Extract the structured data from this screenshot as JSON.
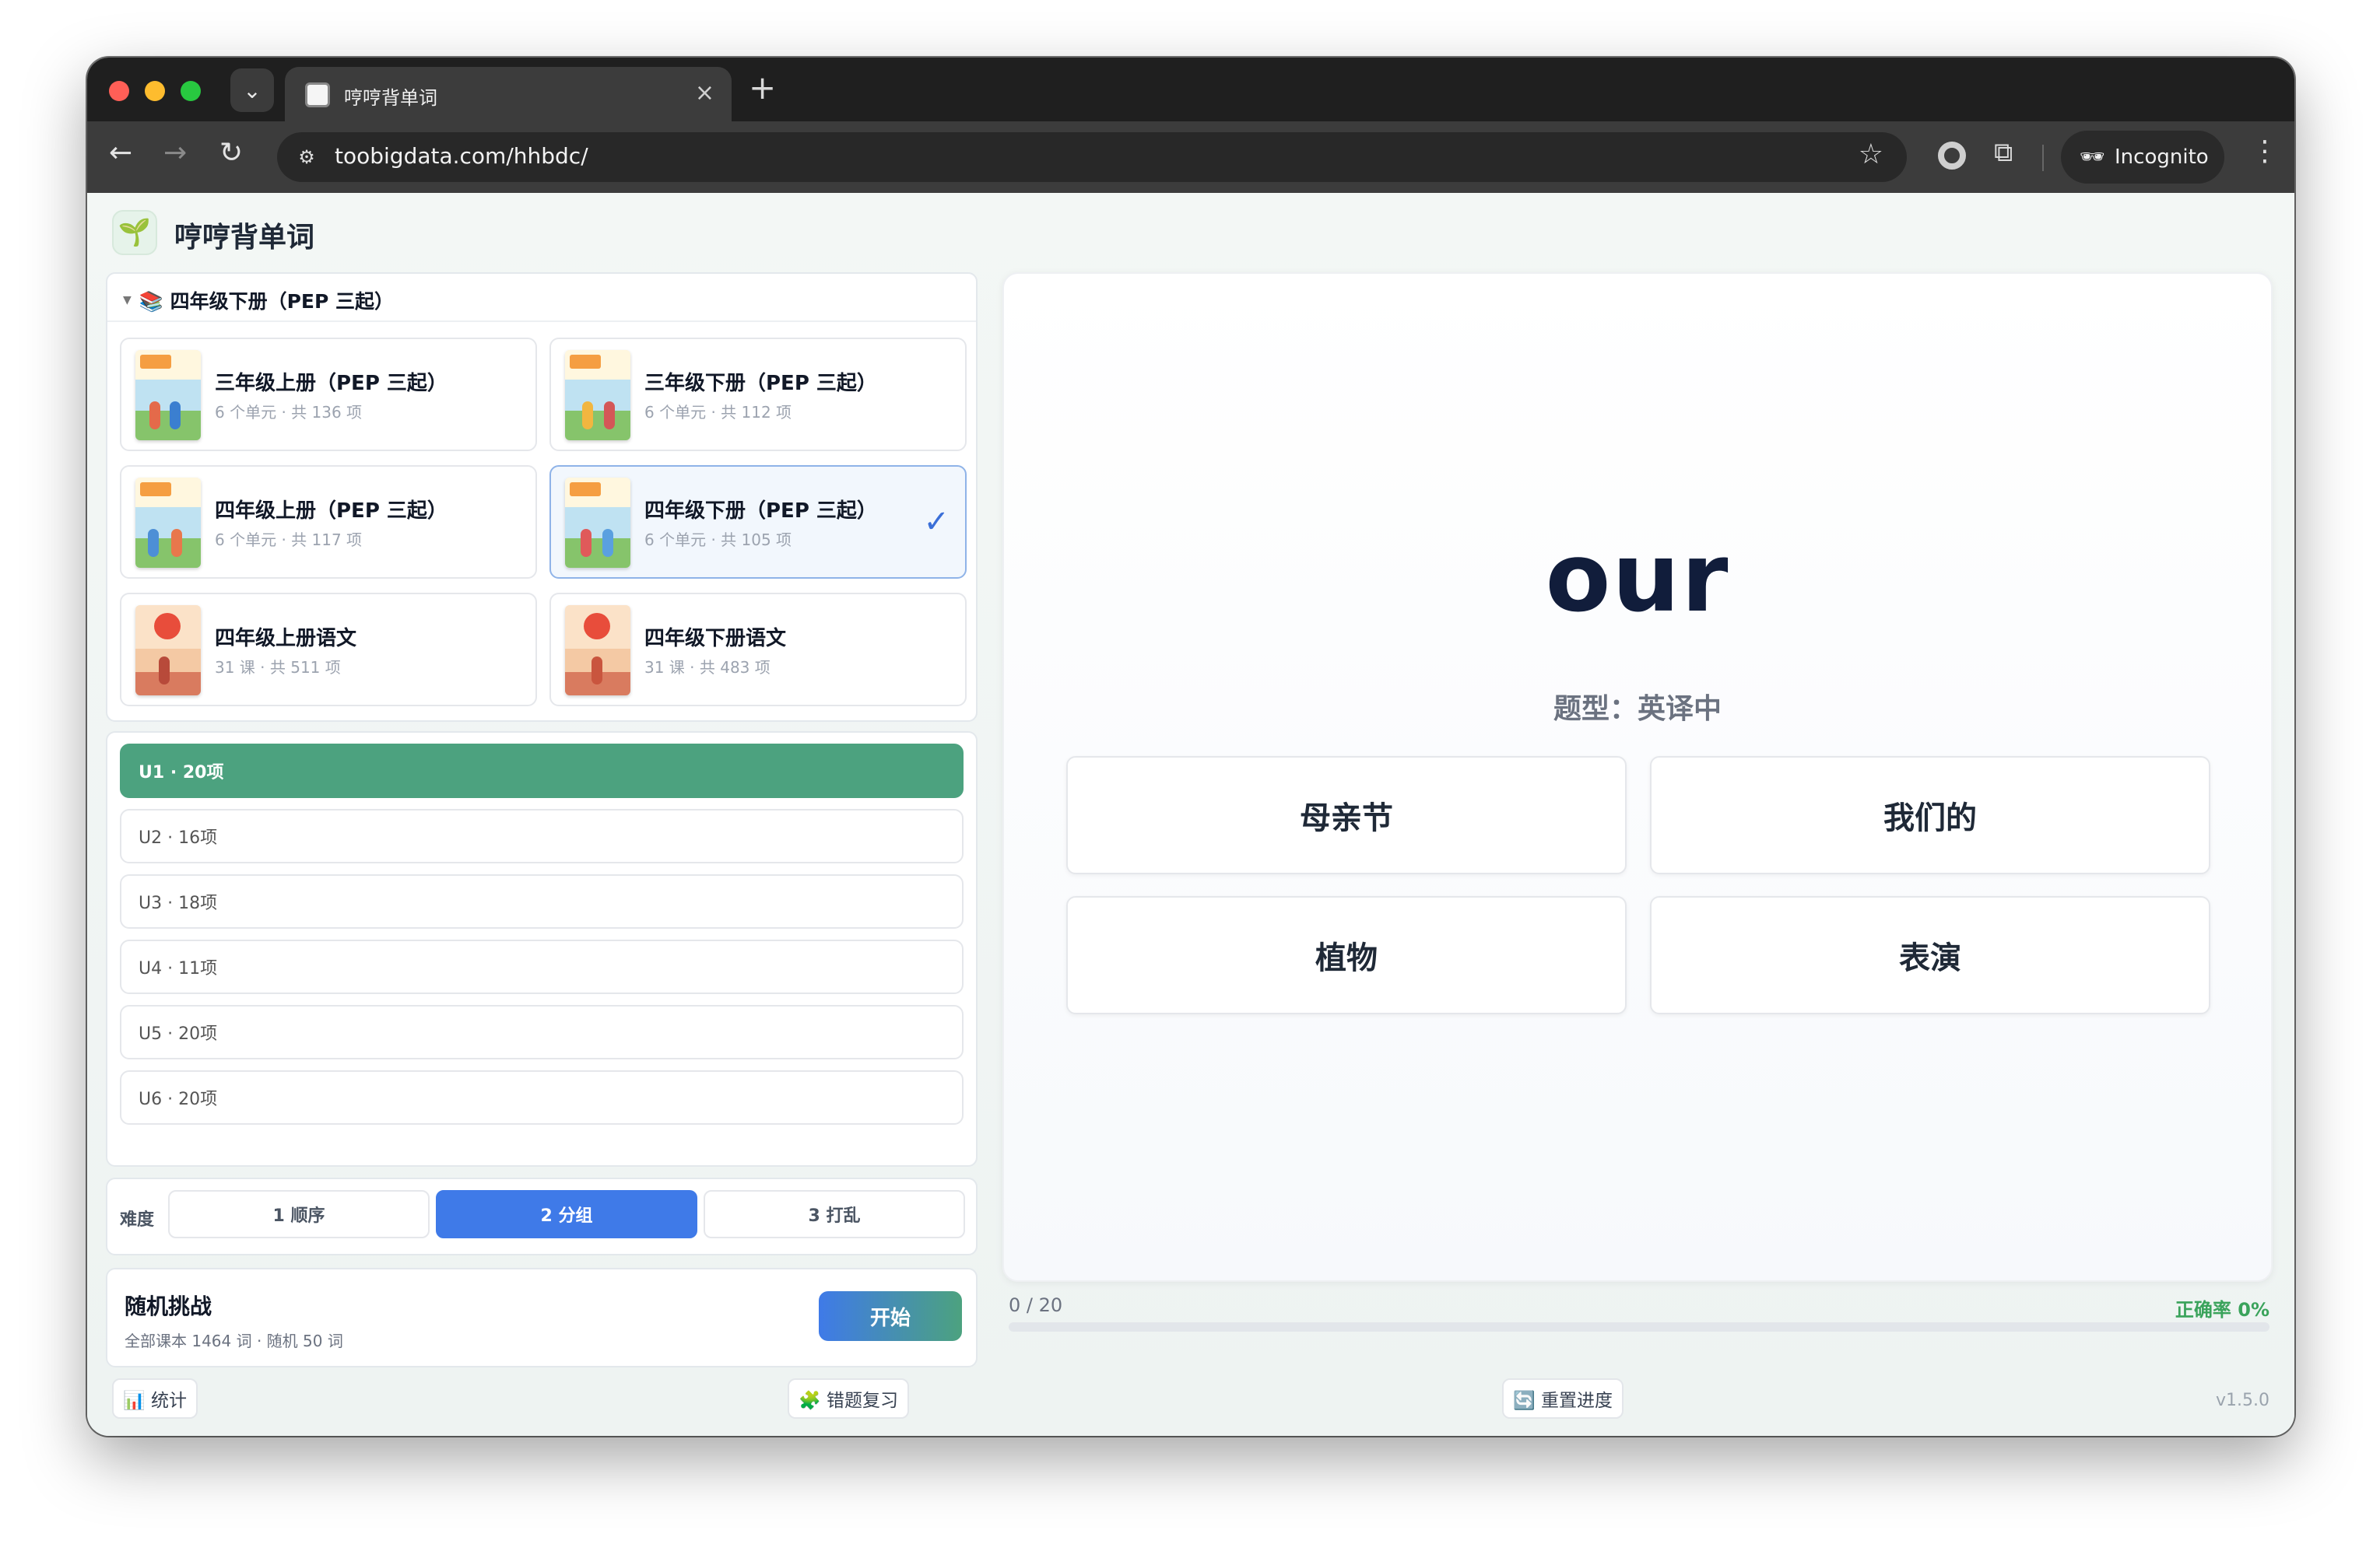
{
  "browser": {
    "tab_title": "哼哼背单词",
    "url": "toobigdata.com/hhbdc/",
    "incognito_label": "Incognito"
  },
  "app": {
    "title": "哼哼背单词",
    "logo_icon": "seedling-icon"
  },
  "book_panel": {
    "header": "📚 四年级下册（PEP 三起）",
    "books": [
      {
        "title": "三年级上册（PEP 三起）",
        "meta": "6 个单元 · 共 136 项",
        "cover": "english",
        "selected": false
      },
      {
        "title": "三年级下册（PEP 三起）",
        "meta": "6 个单元 · 共 112 项",
        "cover": "english",
        "selected": false
      },
      {
        "title": "四年级上册（PEP 三起）",
        "meta": "6 个单元 · 共 117 项",
        "cover": "english",
        "selected": false
      },
      {
        "title": "四年级下册（PEP 三起）",
        "meta": "6 个单元 · 共 105 项",
        "cover": "english",
        "selected": true
      },
      {
        "title": "四年级上册语文",
        "meta": "31 课 · 共 511 项",
        "cover": "chinese",
        "selected": false
      },
      {
        "title": "四年级下册语文",
        "meta": "31 课 · 共 483 项",
        "cover": "chinese",
        "selected": false
      }
    ],
    "check_mark": "✓"
  },
  "units": [
    {
      "label": "U1 · 20项",
      "active": true
    },
    {
      "label": "U2 · 16项",
      "active": false
    },
    {
      "label": "U3 · 18项",
      "active": false
    },
    {
      "label": "U4 · 11项",
      "active": false
    },
    {
      "label": "U5 · 20项",
      "active": false
    },
    {
      "label": "U6 · 20项",
      "active": false
    }
  ],
  "difficulty": {
    "label": "难度",
    "options": [
      "1 顺序",
      "2 分组",
      "3 打乱"
    ],
    "selected_index": 1
  },
  "challenge": {
    "title": "随机挑战",
    "subtitle": "全部课本 1464 词 · 随机 50 词",
    "start_label": "开始"
  },
  "quiz": {
    "word": "our",
    "type_label": "题型：英译中",
    "options": [
      "母亲节",
      "我们的",
      "植物",
      "表演"
    ]
  },
  "progress": {
    "text": "0 / 20",
    "fraction": 0,
    "accuracy": "正确率 0%"
  },
  "footer": {
    "stats_label": "📊 统计",
    "review_label": "🧩 错题复习",
    "reset_label": "🔄 重置进度",
    "version": "v1.5.0"
  },
  "colors": {
    "accent_green": "#4ca27f",
    "accent_blue": "#3f7ae8"
  }
}
